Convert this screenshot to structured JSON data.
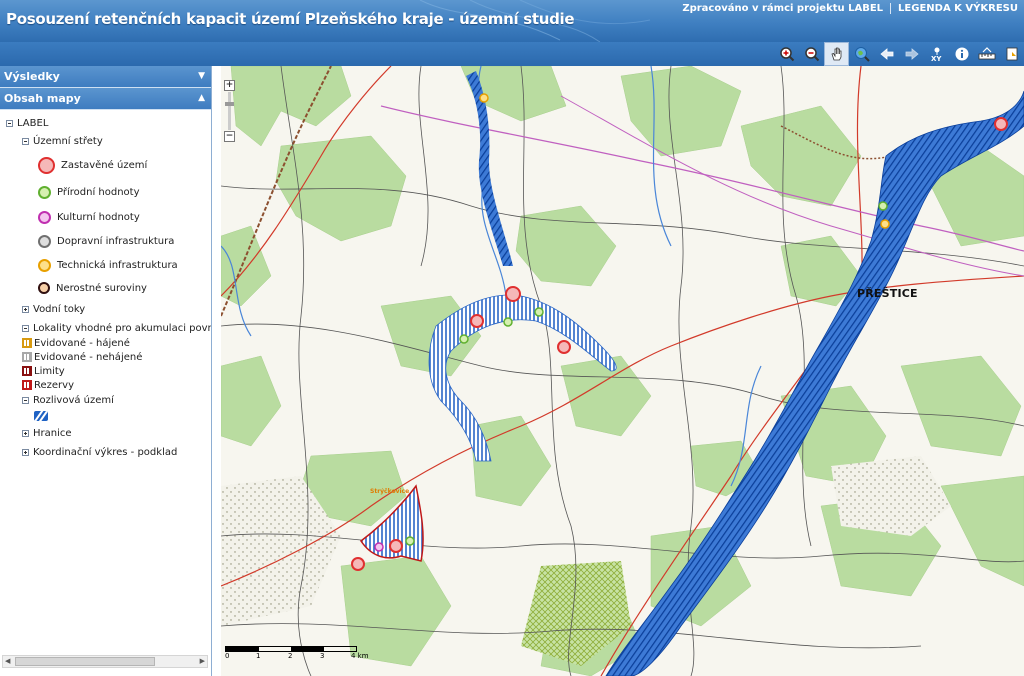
{
  "header": {
    "title": "Posouzení retenčních kapacit území Plzeňského kraje - územní studie",
    "link_project": "Zpracováno v rámci projektu LABEL",
    "link_legend": "LEGENDA K VÝKRESU"
  },
  "toolbar": {
    "tools": [
      "zoom-in-icon",
      "zoom-out-icon",
      "pan-hand-icon",
      "full-extent-icon",
      "back-arrow-icon",
      "forward-arrow-icon",
      "xy-coordinates-icon",
      "info-icon",
      "measure-icon",
      "print-icon"
    ],
    "xy_label": "XY"
  },
  "panel": {
    "results_label": "Výsledky",
    "map_content_label": "Obsah mapy",
    "tree": {
      "root": "LABEL",
      "group_conflicts": "Územní střety",
      "conflict_items": [
        {
          "label": "Zastavěné území",
          "color": "#e03030",
          "fill": "#f5b8b8"
        },
        {
          "label": "Přírodní hodnoty",
          "color": "#60b030",
          "fill": "#d6f0b0"
        },
        {
          "label": "Kulturní hodnoty",
          "color": "#c030b0",
          "fill": "#f4c6ef"
        },
        {
          "label": "Dopravní infrastruktura",
          "color": "#707070",
          "fill": "#dedede"
        },
        {
          "label": "Technická infrastruktura",
          "color": "#e8a000",
          "fill": "#fde08a"
        },
        {
          "label": "Nerostné suroviny",
          "color": "#301010",
          "fill": "#f8d0a8"
        }
      ],
      "water": "Vodní toky",
      "sites": "Lokality vhodné pro akumulaci povrchových vod",
      "site_items": [
        {
          "label": "Evidované - hájené",
          "color": "#d89a10"
        },
        {
          "label": "Evidované - nehájené",
          "color": "#a8a8a8"
        },
        {
          "label": "Limity",
          "color": "#8a1010"
        },
        {
          "label": "Rezervy",
          "color": "#c01818"
        }
      ],
      "flood": "Rozlivová území",
      "borders": "Hranice",
      "coord": "Koordinační výkres - podklad"
    }
  },
  "map": {
    "town_label": "PŘEŠTICE",
    "local_label": "Strýčkovice",
    "scale_ticks": [
      "0",
      "1",
      "2",
      "3",
      "4 km"
    ],
    "colors": {
      "forest": "#b9dca0",
      "water": "#1f62c4",
      "road_red": "#d23a2a",
      "rail": "#8c5030",
      "power": "#c060c0"
    }
  }
}
